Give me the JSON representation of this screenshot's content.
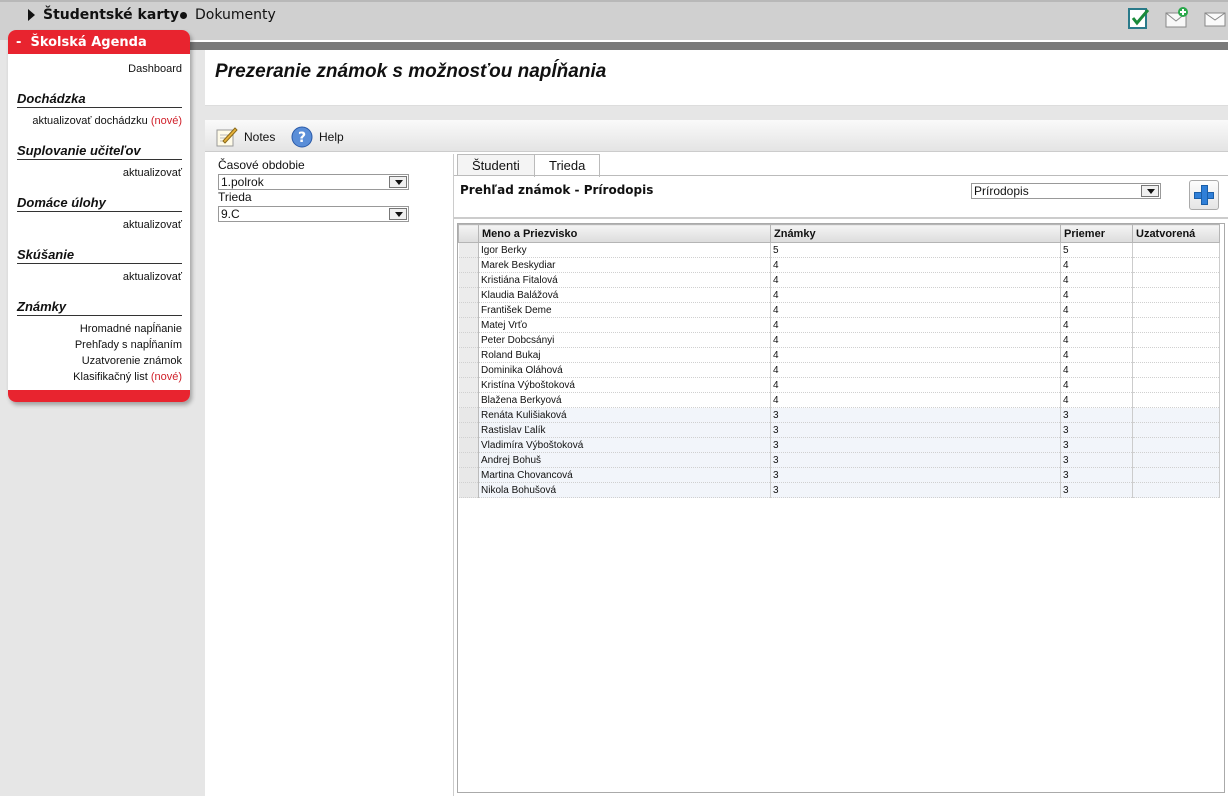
{
  "topnav": {
    "item1": "Študentské karty",
    "item2": "Dokumenty"
  },
  "sidebar": {
    "title": "Školská Agenda",
    "collapse_glyph": "-",
    "dashboard": "Dashboard",
    "sections": {
      "dochadzka": {
        "title": "Dochádzka",
        "link": "aktualizovať dochádzku",
        "badge": "(nové)"
      },
      "suplovanie": {
        "title": "Suplovanie učiteľov",
        "link": "aktualizovať"
      },
      "domace": {
        "title": "Domáce úlohy",
        "link": "aktualizovať"
      },
      "skusanie": {
        "title": "Skúšanie",
        "link": "aktualizovať"
      },
      "znamky": {
        "title": "Známky",
        "links": [
          "Hromadné napĺňanie",
          "Prehľady s napĺňaním",
          "Uzatvorenie známok",
          "Klasifikačný list"
        ],
        "badge": "(nové)"
      }
    }
  },
  "page": {
    "title": "Prezeranie známok s možnosťou napĺňania"
  },
  "toolbar": {
    "notes": "Notes",
    "help": "Help"
  },
  "filters": {
    "period_label": "Časové obdobie",
    "period_value": "1.polrok",
    "class_label": "Trieda",
    "class_value": "9.C"
  },
  "tabs": [
    "Študenti",
    "Trieda"
  ],
  "active_tab": "Trieda",
  "panel": {
    "heading": "Prehľad známok - Prírodopis",
    "subject_value": "Prírodopis"
  },
  "grid": {
    "columns": [
      "Meno a Priezvisko",
      "Známky",
      "Priemer",
      "Uzatvorená"
    ],
    "rows": [
      [
        "Igor Berky",
        "5",
        "5",
        ""
      ],
      [
        "Marek Beskydiar",
        "4",
        "4",
        ""
      ],
      [
        "Kristiána Fitalová",
        "4",
        "4",
        ""
      ],
      [
        "Klaudia Balážová",
        "4",
        "4",
        ""
      ],
      [
        "František Deme",
        "4",
        "4",
        ""
      ],
      [
        "Matej Vrťo",
        "4",
        "4",
        ""
      ],
      [
        "Peter Dobcsányi",
        "4",
        "4",
        ""
      ],
      [
        "Roland Bukaj",
        "4",
        "4",
        ""
      ],
      [
        "Dominika Oláhová",
        "4",
        "4",
        ""
      ],
      [
        "Kristína Výboštoková",
        "4",
        "4",
        ""
      ],
      [
        "Blažena Berkyová",
        "4",
        "4",
        ""
      ],
      [
        "Renáta Kulišiaková",
        "3",
        "3",
        ""
      ],
      [
        "Rastislav Ľalík",
        "3",
        "3",
        ""
      ],
      [
        "Vladimíra Výboštoková",
        "3",
        "3",
        ""
      ],
      [
        "Andrej Bohuš",
        "3",
        "3",
        ""
      ],
      [
        "Martina Chovancová",
        "3",
        "3",
        ""
      ],
      [
        "Nikola Bohušová",
        "3",
        "3",
        ""
      ]
    ]
  },
  "icons": {
    "top_right": [
      "checklist-icon",
      "add-mail-icon",
      "mail-icon"
    ],
    "notes": "notes-pencil-icon",
    "help": "help-question-icon",
    "add": "add-plus-icon"
  },
  "colors": {
    "brand_red": "#e8242f",
    "badge_red": "#d0202a",
    "plus_blue": "#2f7fd8"
  }
}
